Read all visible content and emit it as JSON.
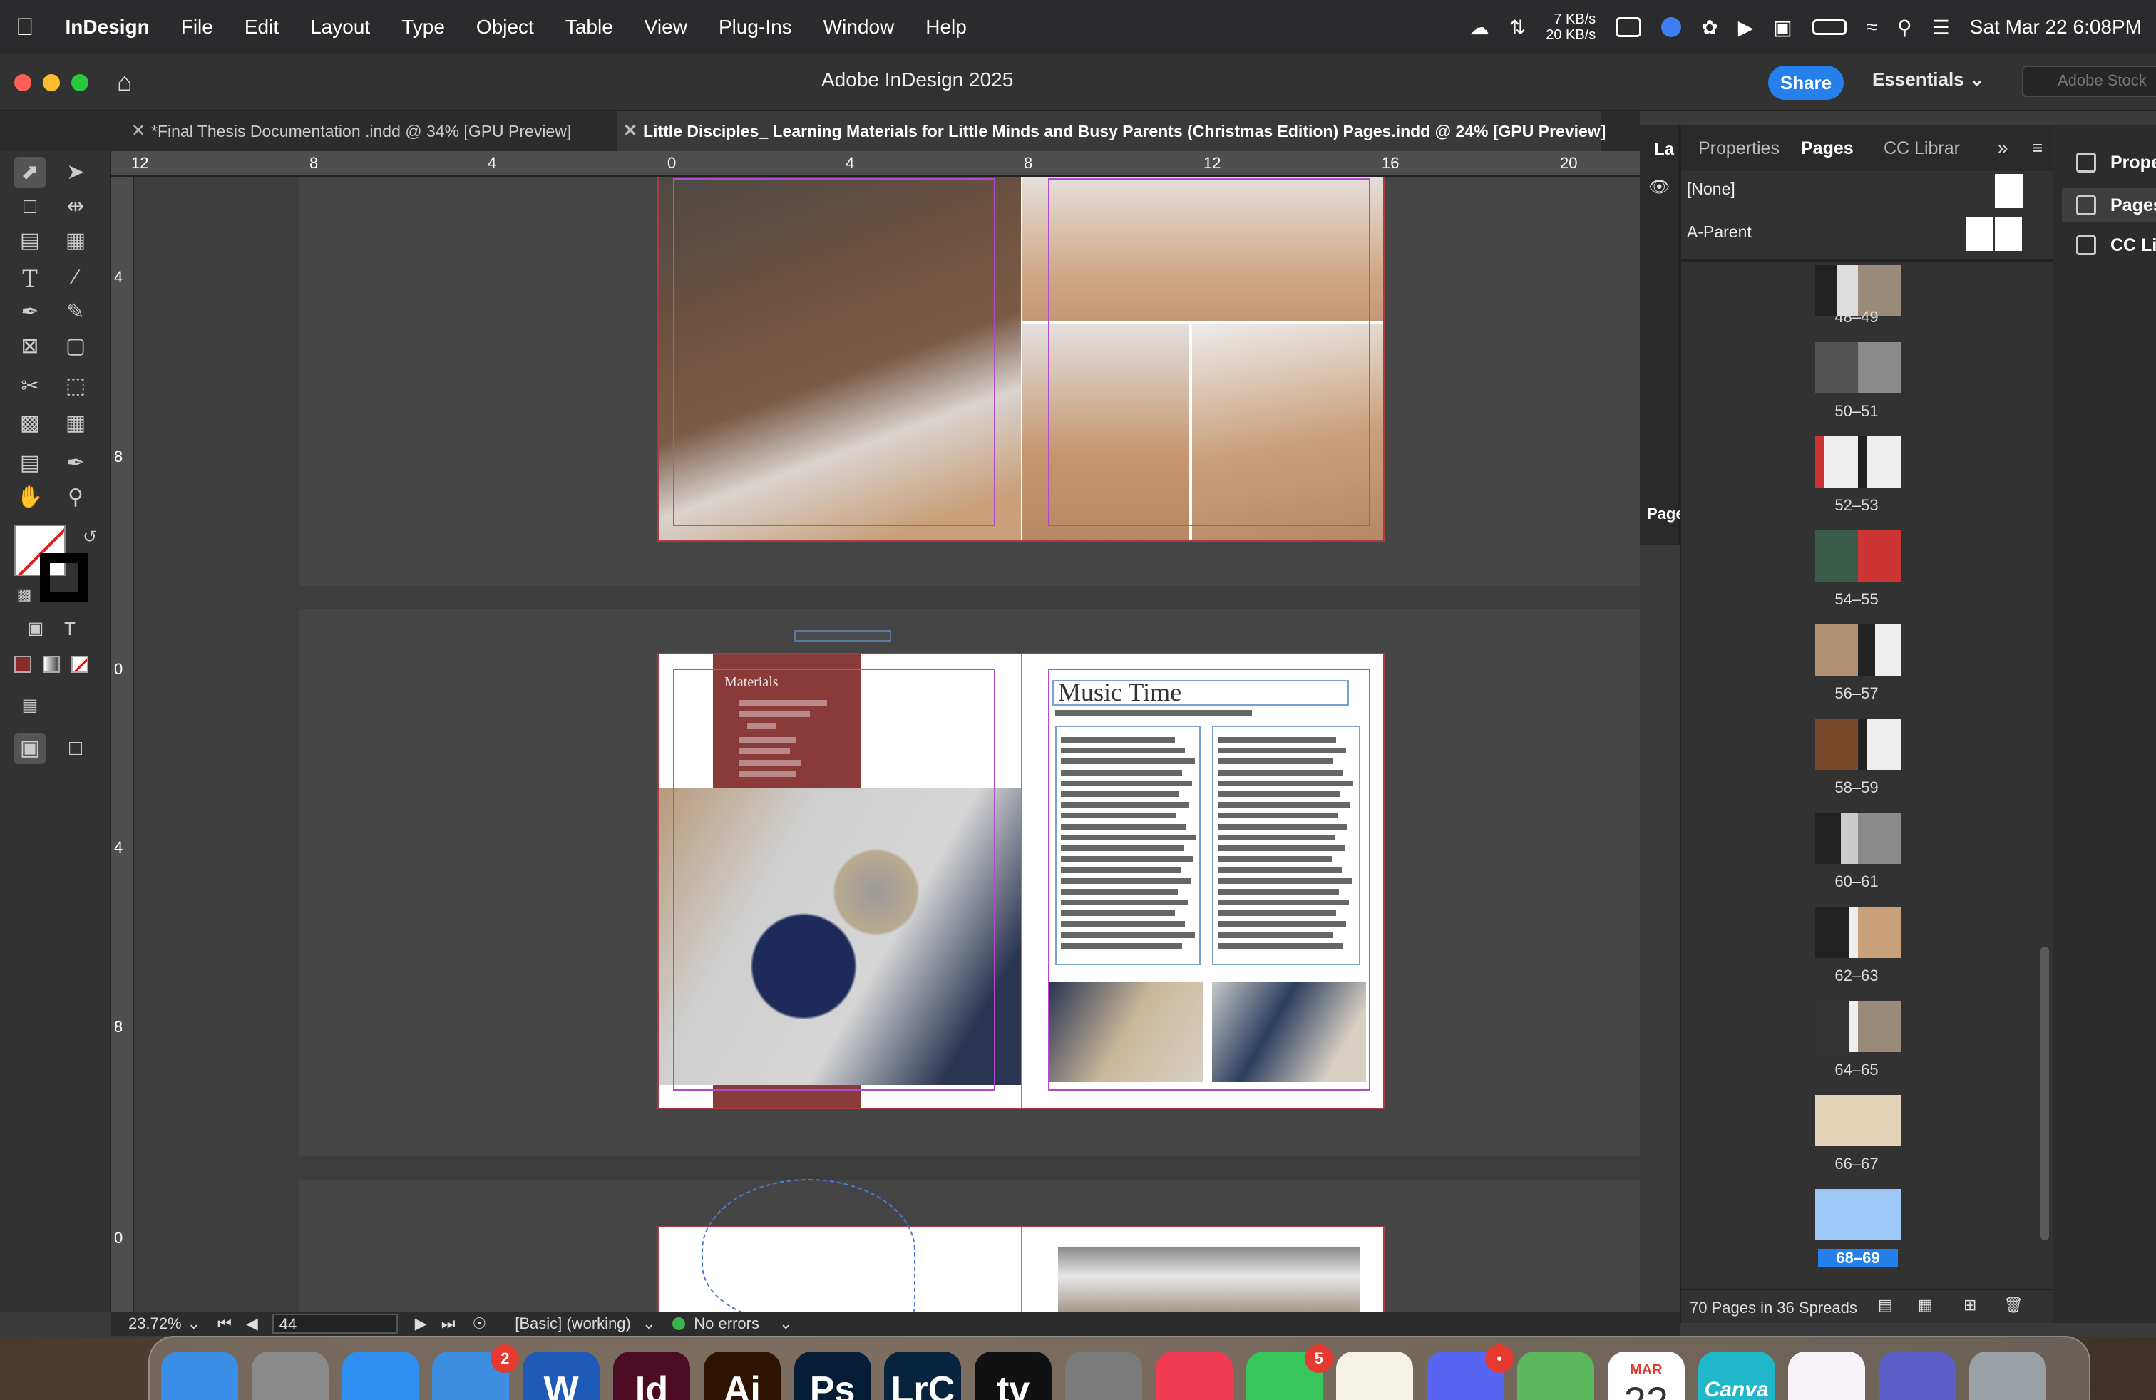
{
  "menubar": {
    "app": "InDesign",
    "items": [
      "File",
      "Edit",
      "Layout",
      "Type",
      "Object",
      "Table",
      "View",
      "Plug-Ins",
      "Window",
      "Help"
    ],
    "net_up": "7 KB/s",
    "net_down": "20 KB/s",
    "datetime": "Sat Mar 22  6:08PM"
  },
  "window": {
    "title": "Adobe InDesign 2025",
    "share_label": "Share",
    "workspace": "Essentials",
    "stock_placeholder": "Adobe Stock"
  },
  "doc_tabs": [
    {
      "label": "*Final Thesis Documentation .indd @ 34% [GPU Preview]"
    },
    {
      "label": "Little Disciples_ Learning Materials for Little Minds and Busy Parents (Christmas Edition) Pages.indd @ 24% [GPU Preview]"
    }
  ],
  "hruler_ticks": [
    "12",
    "8",
    "4",
    "0",
    "4",
    "8",
    "12",
    "16",
    "20"
  ],
  "vruler_ticks": [
    "4",
    "8",
    "0",
    "4",
    "8",
    "0"
  ],
  "spread2": {
    "materials_label": "Materials",
    "heading": "Music Time"
  },
  "status": {
    "zoom": "23.72%",
    "page": "44",
    "preflight_profile": "[Basic] (working)",
    "errors": "No errors"
  },
  "pages_panel": {
    "tabs": [
      "Properties",
      "Pages",
      "CC Librar"
    ],
    "layer_stub_label": "La",
    "page_stub_label": "Page",
    "masters": [
      {
        "label": "[None]"
      },
      {
        "label": "A-Parent"
      }
    ],
    "spreads": [
      "48–49",
      "50–51",
      "52–53",
      "54–55",
      "56–57",
      "58–59",
      "60–61",
      "62–63",
      "64–65",
      "66–67",
      "68–69"
    ],
    "selected_spread": "68–69",
    "footer": "70 Pages in 36 Spreads"
  },
  "side_panel": {
    "items": [
      "Properties",
      "Pages",
      "CC Libraries"
    ]
  },
  "dock": {
    "icons": [
      {
        "name": "finder",
        "label": "",
        "color": "#3a8ee6"
      },
      {
        "name": "launchpad",
        "label": "",
        "color": "#8a8a8a"
      },
      {
        "name": "safari",
        "label": "",
        "color": "#2f8ff0"
      },
      {
        "name": "mail",
        "label": "",
        "color": "#3d8de0",
        "badge": "2"
      },
      {
        "name": "word",
        "label": "W",
        "color": "#1e5bb8"
      },
      {
        "name": "indesign",
        "label": "Id",
        "color": "#4b0c24"
      },
      {
        "name": "illustrator",
        "label": "Ai",
        "color": "#2e1400"
      },
      {
        "name": "photoshop",
        "label": "Ps",
        "color": "#061e35"
      },
      {
        "name": "lightroom-classic",
        "label": "LrC",
        "color": "#07233d"
      },
      {
        "name": "apple-tv",
        "label": "tv",
        "color": "#111111"
      },
      {
        "name": "system-settings",
        "label": "",
        "color": "#7a7a7a"
      },
      {
        "name": "music",
        "label": "",
        "color": "#f03b52"
      },
      {
        "name": "messages",
        "label": "",
        "color": "#38c65a",
        "badge": "5"
      },
      {
        "name": "notes",
        "label": "",
        "color": "#f4f1e6"
      },
      {
        "name": "discord",
        "label": "",
        "color": "#5865f2",
        "badge": "•"
      },
      {
        "name": "maps",
        "label": "",
        "color": "#5cb85c"
      },
      {
        "name": "calendar",
        "label": "22",
        "month": "MAR",
        "color": "#ffffff"
      },
      {
        "name": "canva",
        "label": "Canva",
        "color": "#1fb7c9"
      },
      {
        "name": "copilot",
        "label": "",
        "color": "#f6f4f8"
      },
      {
        "name": "teams",
        "label": "",
        "color": "#5b5fc7"
      },
      {
        "name": "trash",
        "label": "",
        "color": "#9aa0a6"
      }
    ]
  },
  "colors": {
    "accent": "#2680eb",
    "spread_border": "#aa3a44",
    "materials_box": "#8b3a3a",
    "guide": "#b04bd0"
  }
}
